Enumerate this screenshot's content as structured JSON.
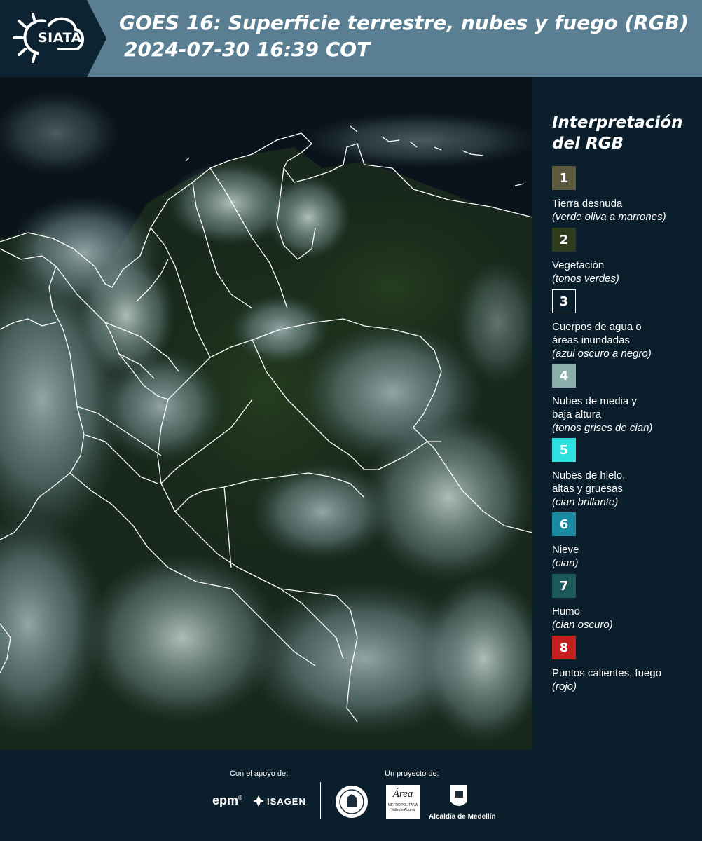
{
  "header": {
    "logo_text": "SIATA",
    "title_line1": "GOES 16: Superficie terrestre, nubes y fuego (RGB)",
    "title_line2": "2024-07-30 16:39 COT"
  },
  "legend": {
    "title_line1": "Interpretación",
    "title_line2": "del RGB",
    "items": [
      {
        "num": "1",
        "color": "#5c5a3e",
        "lines": [
          "Tierra desnuda"
        ],
        "sub": "(verde oliva a marrones)"
      },
      {
        "num": "2",
        "color": "#2e3d1e",
        "lines": [
          "Vegetación"
        ],
        "sub": "(tonos verdes)"
      },
      {
        "num": "3",
        "color": "#0b1e2b",
        "lines": [
          "Cuerpos de agua o",
          "áreas inundadas"
        ],
        "sub": "(azul oscuro a negro)"
      },
      {
        "num": "4",
        "color": "#8aaeaa",
        "lines": [
          "Nubes de media y",
          "baja altura"
        ],
        "sub": "(tonos grises de cian)"
      },
      {
        "num": "5",
        "color": "#2ee0df",
        "lines": [
          "Nubes de hielo,",
          "altas y gruesas"
        ],
        "sub": "(cian brillante)"
      },
      {
        "num": "6",
        "color": "#1a8aa0",
        "lines": [
          "Nieve"
        ],
        "sub": "(cian)"
      },
      {
        "num": "7",
        "color": "#1c5a5a",
        "lines": [
          "Humo"
        ],
        "sub": "(cian oscuro)"
      },
      {
        "num": "8",
        "color": "#c0201e",
        "lines": [
          "Puntos calientes, fuego"
        ],
        "sub": "(rojo)"
      }
    ]
  },
  "footer": {
    "support_label": "Con el apoyo de:",
    "project_label": "Un proyecto de:",
    "epm": "epm",
    "isagen": "ISAGEN",
    "area_line1": "Área",
    "area_line2": "METROPOLITANA",
    "area_line3": "Valle de Aburrá",
    "alcaldia": "Alcaldía de Medellín"
  }
}
